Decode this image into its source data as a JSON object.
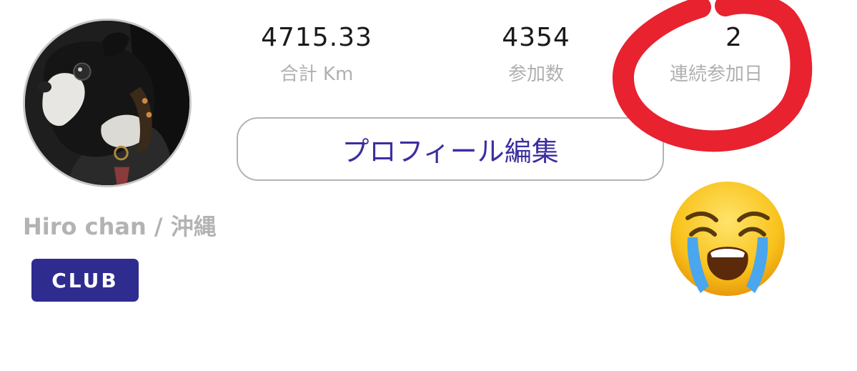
{
  "profile": {
    "username": "Hiro chan / 沖縄",
    "club_label": "CLUB",
    "edit_button_label": "プロフィール編集"
  },
  "stats": [
    {
      "value": "4715.33",
      "label": "合計 Km"
    },
    {
      "value": "4354",
      "label": "参加数"
    },
    {
      "value": "2",
      "label": "連続参加日"
    }
  ],
  "icons": {
    "avatar": "dog-photo",
    "annotation": "red-circle-annotation",
    "emoji": "loudly-crying-face-emoji"
  },
  "colors": {
    "accent": "#3b2ea0",
    "club_badge": "#2f2c90",
    "annotation": "#e8222f",
    "muted_text": "#b0b0b0"
  }
}
